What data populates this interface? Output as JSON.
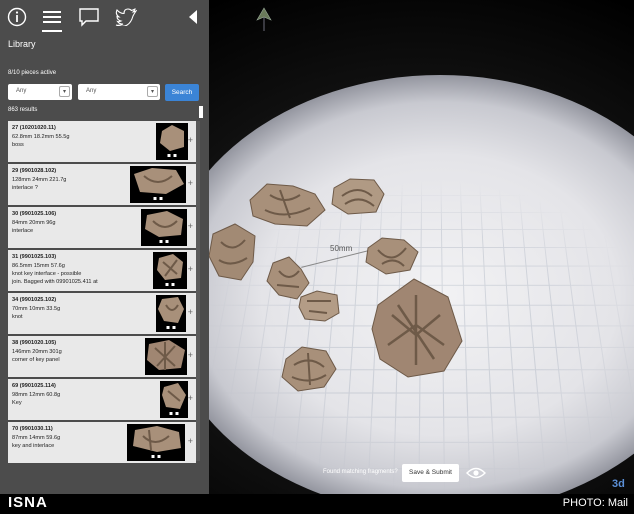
{
  "sidebar": {
    "nav": {
      "icons": [
        "info-icon",
        "menu-icon",
        "comment-icon",
        "twitter-icon"
      ],
      "back_icon": "collapse-arrow-icon"
    },
    "title": "Library",
    "pieces_active": "8/10 pieces active",
    "filter1_value": "Any",
    "filter2_value": "Any",
    "search_label": "Search",
    "results_count": "863 results",
    "items": [
      {
        "title": "27 (10201020.11)",
        "line1": "62.8mm 18.2mm 55.5g",
        "line2": "boss",
        "line3": ""
      },
      {
        "title": "29 (9901028.102)",
        "line1": "128mm 24mm 221.7g",
        "line2": "interlace ?",
        "line3": ""
      },
      {
        "title": "30 (9901025.106)",
        "line1": "84mm 20mm 96g",
        "line2": "interlace",
        "line3": ""
      },
      {
        "title": "31 (9901025.103)",
        "line1": "86.5mm 15mm 57.6g",
        "line2": "knot key interface - possible",
        "line3": "join. Bagged with 09901025.411 at"
      },
      {
        "title": "34 (9901025.102)",
        "line1": "70mm 10mm 33.5g",
        "line2": "knot",
        "line3": ""
      },
      {
        "title": "38 (9901020.105)",
        "line1": "146mm 20mm 301g",
        "line2": "corner of key panel",
        "line3": ""
      },
      {
        "title": "69 (9901025.114)",
        "line1": "98mm 12mm 60.8g",
        "line2": "Key",
        "line3": ""
      },
      {
        "title": "70 (9901030.11)",
        "line1": "87mm 14mm 59.6g",
        "line2": "key and interlace",
        "line3": ""
      }
    ]
  },
  "viewport": {
    "scale_label": "50mm",
    "found_label": "Found matching fragments?",
    "submit_label": "Save & Submit",
    "view_icon": "eye-icon",
    "logo": "3d"
  },
  "footer": {
    "agency": "ISNA",
    "credit": "PHOTO: Mail"
  },
  "colors": {
    "sidebar_bg": "#4c4c4c",
    "accent": "#3b84d6",
    "fragment": "#a8907a"
  }
}
